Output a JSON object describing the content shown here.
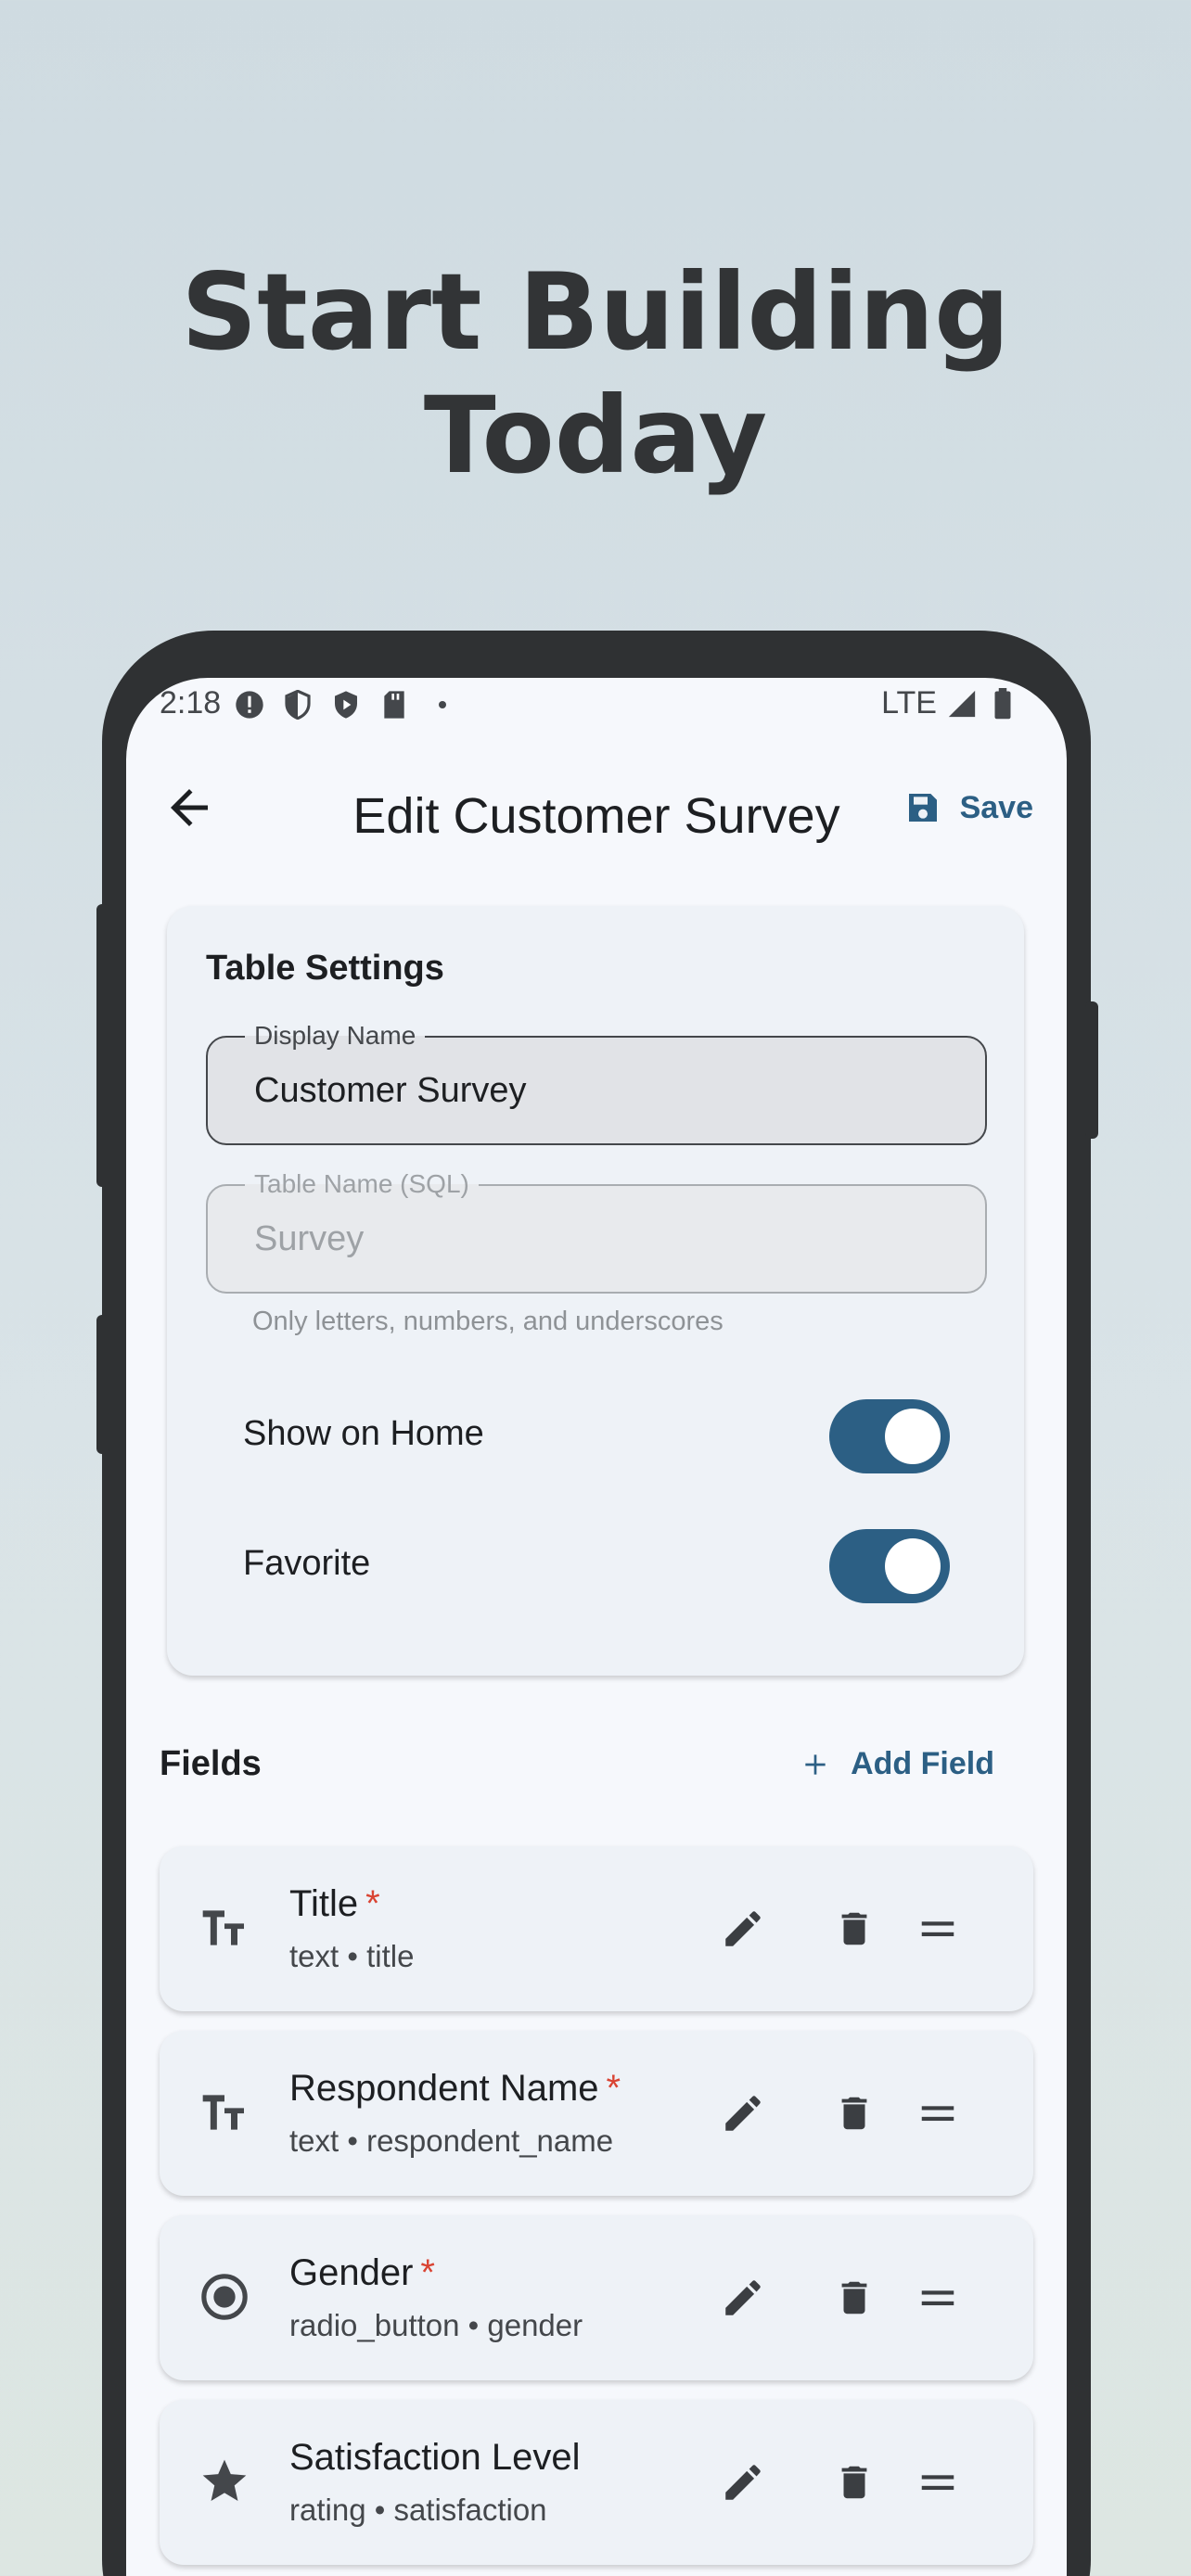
{
  "headline": "Start Building Today",
  "status_bar": {
    "time": "2:18",
    "network": "LTE",
    "icons": [
      "alert-icon",
      "shield-icon",
      "play-icon",
      "sd-card-icon",
      "dot-icon",
      "signal-icon",
      "battery-icon"
    ]
  },
  "app_bar": {
    "title": "Edit Customer Survey",
    "save_label": "Save"
  },
  "table_settings": {
    "title": "Table Settings",
    "display_name": {
      "label": "Display Name",
      "value": "Customer Survey"
    },
    "table_name": {
      "label": "Table Name (SQL)",
      "value": "Survey",
      "helper": "Only letters, numbers, and underscores"
    },
    "show_on_home": {
      "label": "Show on Home",
      "on": true
    },
    "favorite": {
      "label": "Favorite",
      "on": true
    }
  },
  "fields": {
    "title": "Fields",
    "add_label": "Add Field",
    "items": [
      {
        "name": "Title",
        "required": "*",
        "meta": "text • title",
        "icon": "text-fields-icon"
      },
      {
        "name": "Respondent Name",
        "required": "*",
        "meta": "text • respondent_name",
        "icon": "text-fields-icon"
      },
      {
        "name": "Gender",
        "required": "*",
        "meta": "radio_button • gender",
        "icon": "radio-button-icon"
      },
      {
        "name": "Satisfaction Level",
        "required": "",
        "meta": "rating • satisfaction",
        "icon": "star-icon"
      }
    ]
  },
  "colors": {
    "accent": "#2c5f84",
    "required": "#d94433",
    "background_top": "#cfdbe1",
    "phone_frame": "#2f3133"
  }
}
